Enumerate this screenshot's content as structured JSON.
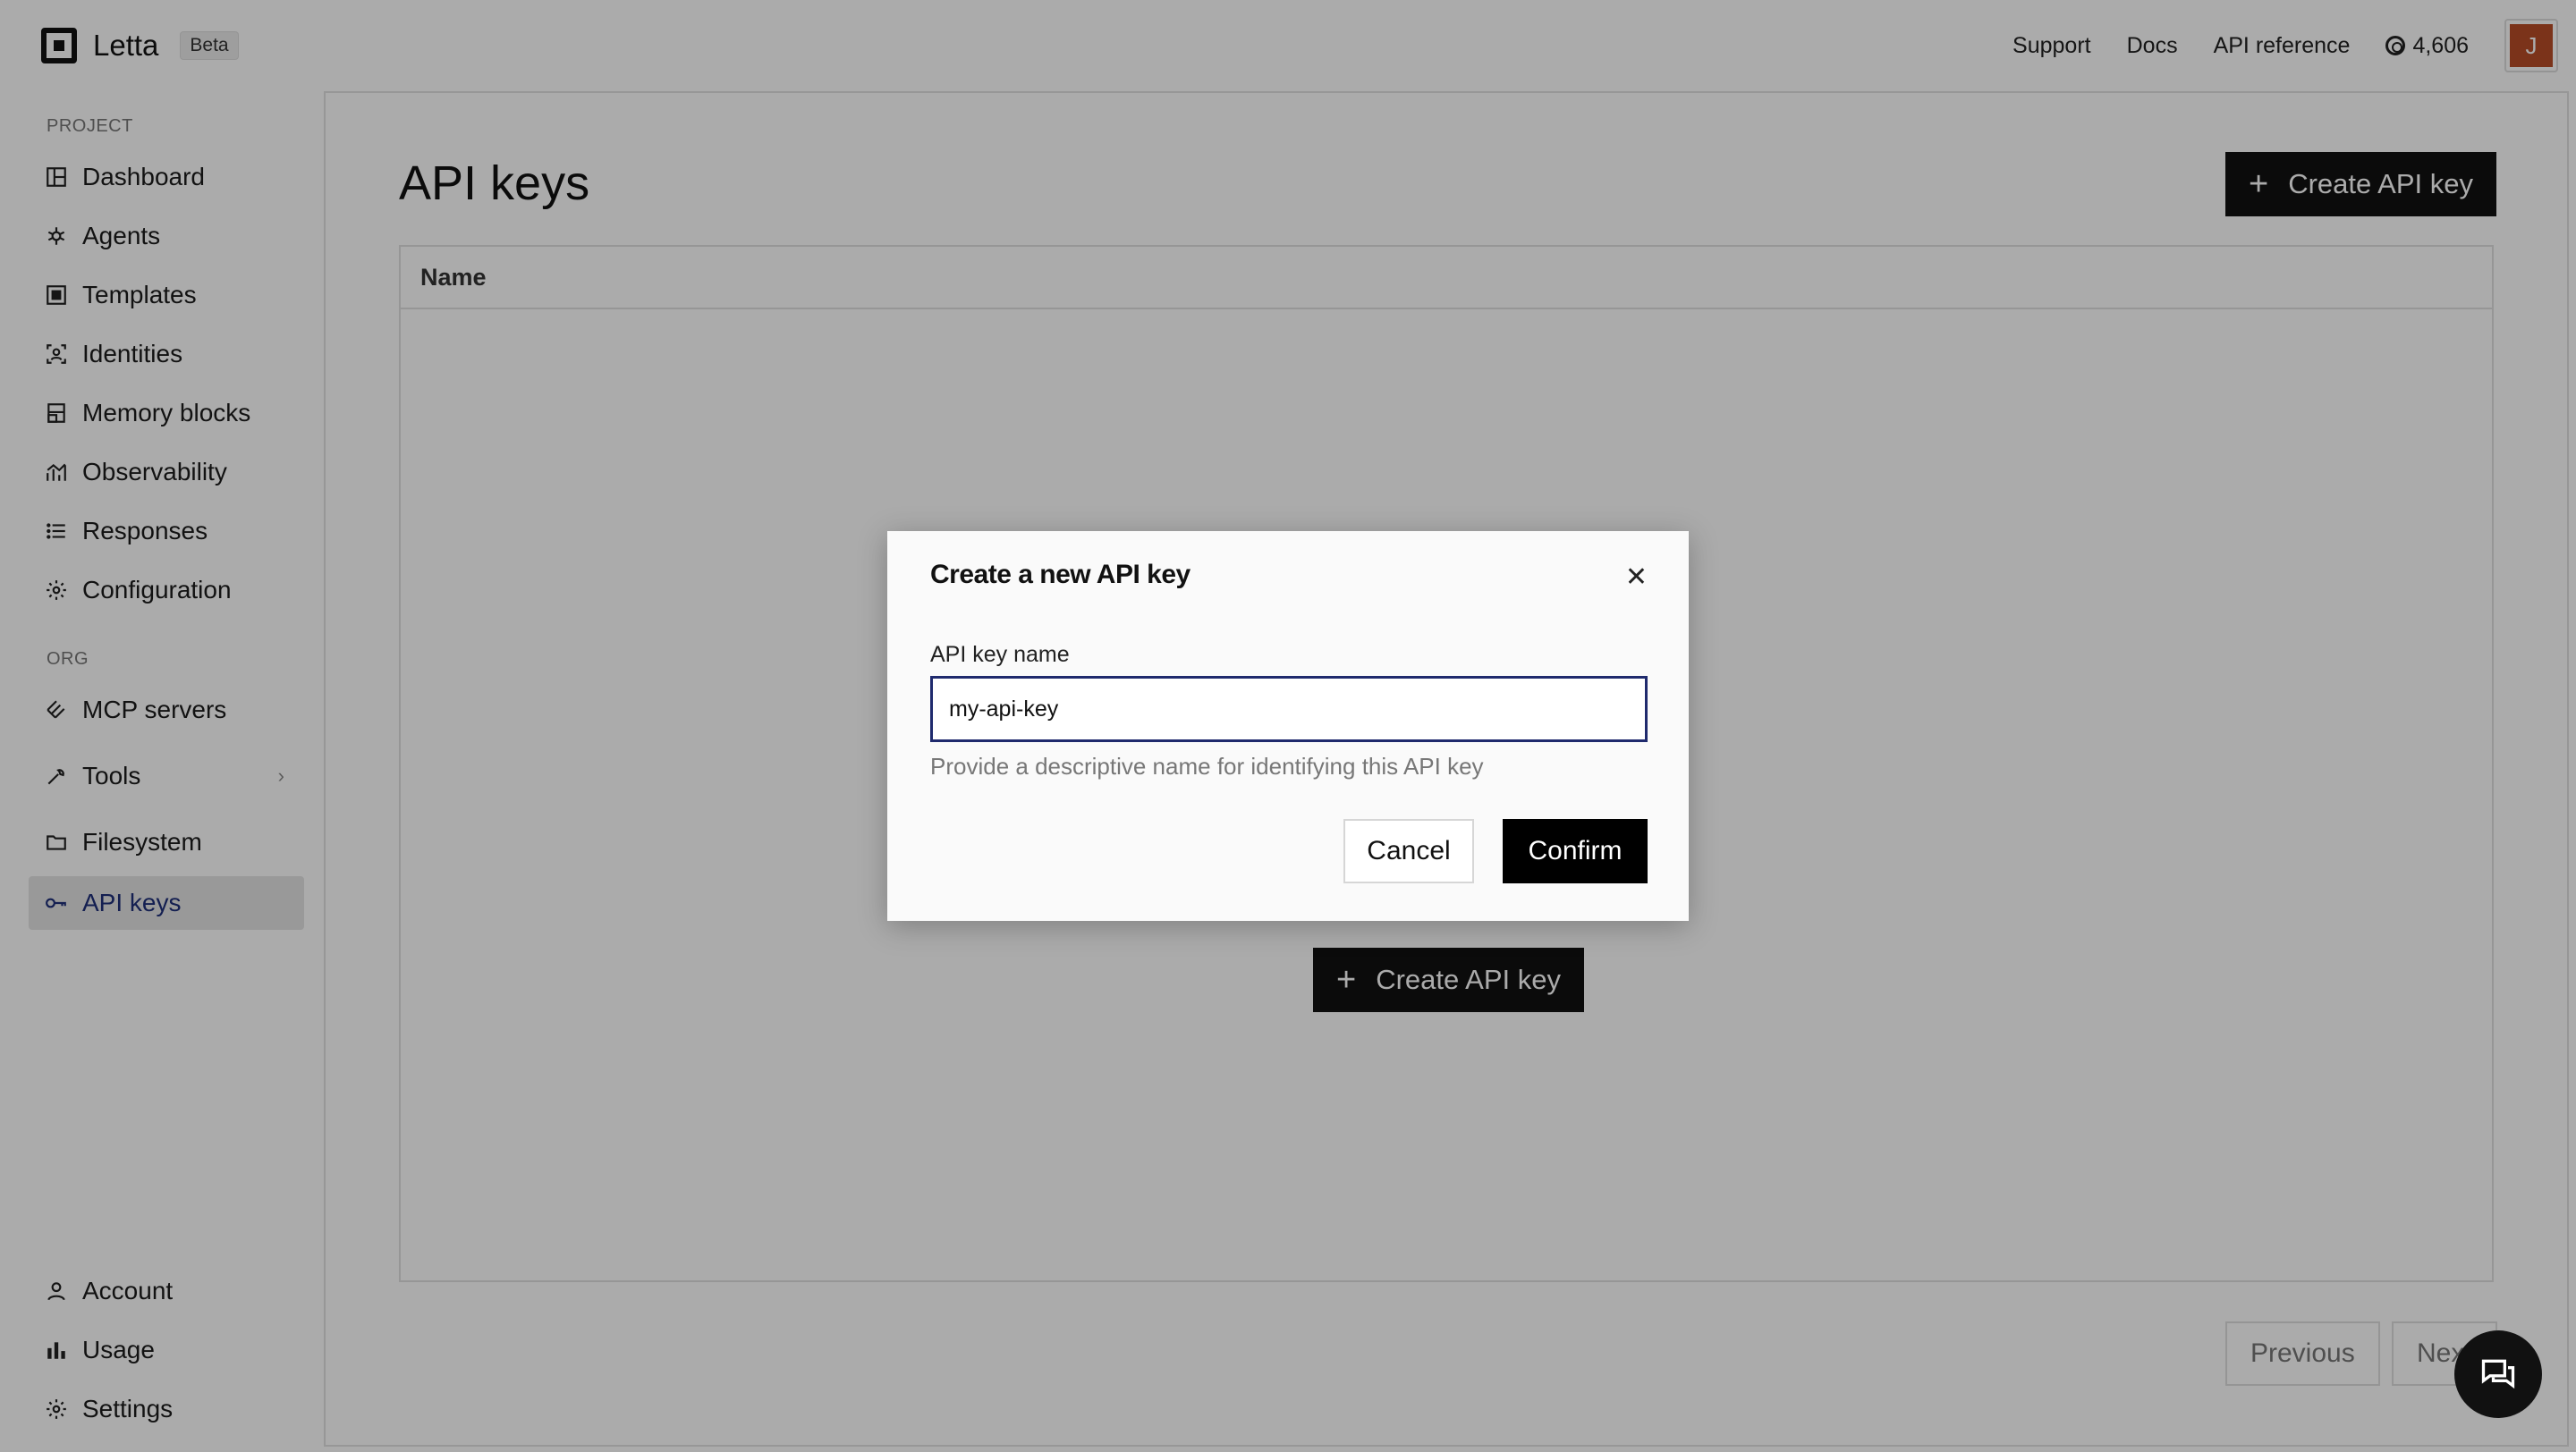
{
  "topbar": {
    "brand": "Letta",
    "badge": "Beta",
    "links": [
      "Support",
      "Docs",
      "API reference"
    ],
    "credits": "4,606",
    "avatar_initial": "J"
  },
  "sidebar": {
    "project_label": "PROJECT",
    "project_items": [
      {
        "label": "Dashboard",
        "icon": "dashboard-icon"
      },
      {
        "label": "Agents",
        "icon": "agents-icon"
      },
      {
        "label": "Templates",
        "icon": "templates-icon"
      },
      {
        "label": "Identities",
        "icon": "identities-icon"
      },
      {
        "label": "Memory blocks",
        "icon": "memory-blocks-icon"
      },
      {
        "label": "Observability",
        "icon": "observability-icon"
      },
      {
        "label": "Responses",
        "icon": "responses-icon"
      },
      {
        "label": "Configuration",
        "icon": "gear-icon"
      }
    ],
    "org_label": "ORG",
    "org_items": [
      {
        "label": "MCP servers",
        "icon": "mcp-icon"
      },
      {
        "label": "Tools",
        "icon": "tools-icon"
      },
      {
        "label": "Filesystem",
        "icon": "folder-icon"
      },
      {
        "label": "API keys",
        "icon": "key-icon",
        "active": true
      }
    ],
    "bottom_items": [
      {
        "label": "Account",
        "icon": "user-icon"
      },
      {
        "label": "Usage",
        "icon": "bar-chart-icon"
      },
      {
        "label": "Settings",
        "icon": "gear-icon"
      }
    ]
  },
  "main": {
    "title": "API keys",
    "create_button": "Create API key",
    "table_header": "Name",
    "empty_create_button": "Create API key",
    "pagination": {
      "previous": "Previous",
      "next": "Next"
    }
  },
  "dialog": {
    "title": "Create a new API key",
    "field_label": "API key name",
    "field_value": "my-api-key",
    "help_text": "Provide a descriptive name for identifying this API key",
    "cancel": "Cancel",
    "confirm": "Confirm"
  },
  "colors": {
    "primary": "#111111",
    "active_text": "#1f2f7a",
    "focus_border": "#1f2a6d",
    "avatar_bg": "#b84c28"
  }
}
